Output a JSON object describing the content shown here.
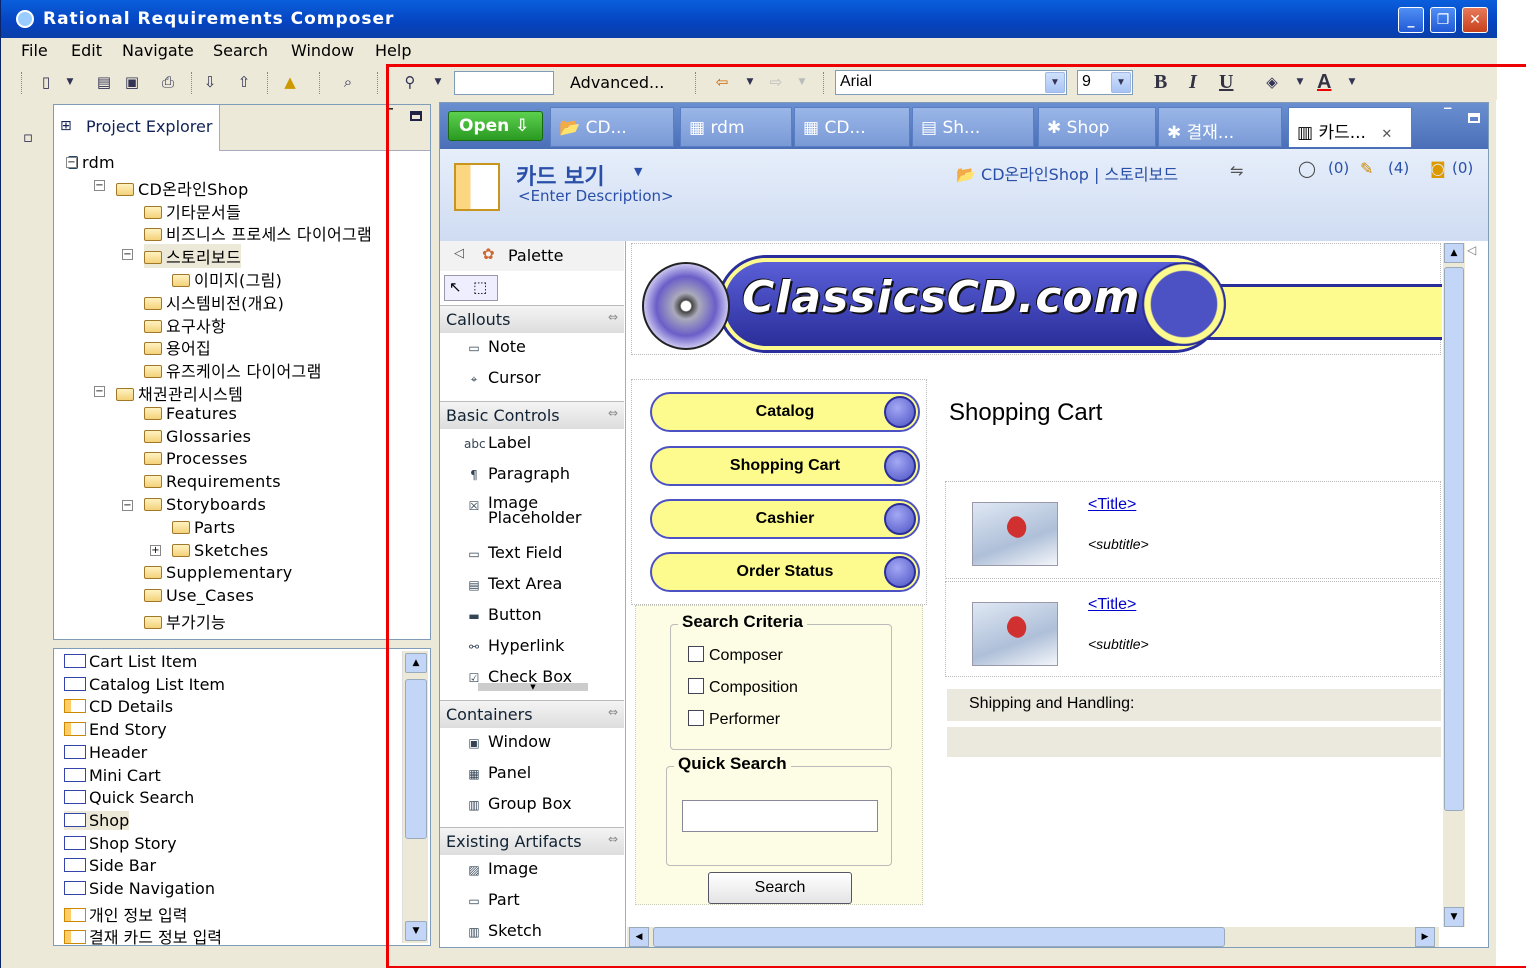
{
  "window": {
    "title": "Rational Requirements Composer",
    "minimize": "_",
    "maximize": "❐",
    "close": "✕"
  },
  "menu": [
    "File",
    "Edit",
    "Navigate",
    "Search",
    "Window",
    "Help"
  ],
  "toolbar": {
    "search_value": "",
    "advanced_label": "Advanced...",
    "font_name": "Arial",
    "font_size": "9",
    "bold": "B",
    "italic": "I",
    "underline": "U",
    "font_color_label": "A"
  },
  "project_explorer": {
    "tab_label": "Project Explorer",
    "tree": [
      {
        "label": "rdm",
        "level": 0
      },
      {
        "label": "CD온라인Shop",
        "level": 1
      },
      {
        "label": "기타문서들",
        "level": 2
      },
      {
        "label": "비즈니스 프로세스 다이어그램",
        "level": 2
      },
      {
        "label": "스토리보드",
        "level": 2,
        "selected": true
      },
      {
        "label": "이미지(그림)",
        "level": 3
      },
      {
        "label": "시스템비전(개요)",
        "level": 2
      },
      {
        "label": "요구사항",
        "level": 2
      },
      {
        "label": "용어집",
        "level": 2
      },
      {
        "label": "유즈케이스 다이어그램",
        "level": 2
      },
      {
        "label": "채권관리시스템",
        "level": 1
      },
      {
        "label": "Features",
        "level": 2
      },
      {
        "label": "Glossaries",
        "level": 2
      },
      {
        "label": "Processes",
        "level": 2
      },
      {
        "label": "Requirements",
        "level": 2
      },
      {
        "label": "Storyboards",
        "level": 2
      },
      {
        "label": "Parts",
        "level": 3
      },
      {
        "label": "Sketches",
        "level": 3
      },
      {
        "label": "Supplementary",
        "level": 2
      },
      {
        "label": "Use_Cases",
        "level": 2
      },
      {
        "label": "부가기능",
        "level": 2
      }
    ]
  },
  "artifacts_list": [
    "Cart List Item",
    "Catalog List Item",
    "CD Details",
    "End Story",
    "Header",
    "Mini Cart",
    "Quick Search",
    "Shop",
    "Shop Story",
    "Side Bar",
    "Side Navigation",
    "개인 정보 입력",
    "결재 카드 정보 입력"
  ],
  "editor_tabs": [
    "Open",
    "CD...",
    "rdm",
    "CD...",
    "Sh...",
    "Shop",
    "결재...",
    "카드..."
  ],
  "editor_header": {
    "title": "카드 보기",
    "description": "<Enter Description>",
    "breadcrumb": "CD온라인Shop | 스토리보드",
    "comments": "(0)",
    "edits": "(4)",
    "links": "(0)"
  },
  "palette": {
    "title": "Palette",
    "sections": [
      {
        "name": "Callouts",
        "items": [
          "Note",
          "Cursor"
        ]
      },
      {
        "name": "Basic Controls",
        "items": [
          "Label",
          "Paragraph",
          "Image Placeholder",
          "Text Field",
          "Text Area",
          "Button",
          "Hyperlink",
          "Check Box"
        ]
      },
      {
        "name": "Containers",
        "items": [
          "Window",
          "Panel",
          "Group Box"
        ]
      },
      {
        "name": "Existing Artifacts",
        "items": [
          "Image",
          "Part",
          "Sketch"
        ]
      }
    ]
  },
  "sketch": {
    "logo": "ClassicsCD.com",
    "nav": [
      "Catalog",
      "Shopping Cart",
      "Cashier",
      "Order Status"
    ],
    "heading": "Shopping Cart",
    "search_criteria": {
      "title": "Search Criteria",
      "options": [
        "Composer",
        "Composition",
        "Performer"
      ]
    },
    "quick_search": {
      "title": "Quick Search",
      "button": "Search"
    },
    "items": [
      {
        "title": "<Title>",
        "subtitle": "<subtitle>"
      },
      {
        "title": "<Title>",
        "subtitle": "<subtitle>"
      }
    ],
    "shipping": "Shipping and Handling:"
  }
}
